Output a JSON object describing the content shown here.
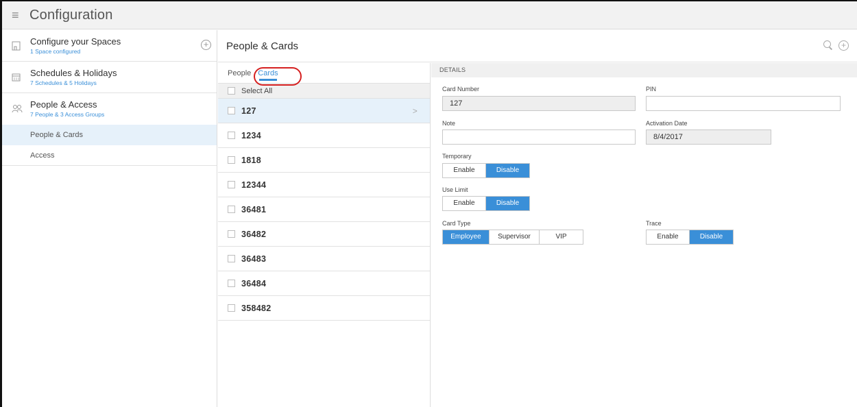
{
  "app": {
    "title": "Configuration"
  },
  "sidebar": {
    "items": [
      {
        "label": "Configure your Spaces",
        "sub": "1 Space configured",
        "add": "+"
      },
      {
        "label": "Schedules & Holidays",
        "sub": "7 Schedules & 5 Holidays"
      },
      {
        "label": "People & Access",
        "sub": "7 People & 3 Access Groups"
      }
    ],
    "subitems": [
      {
        "label": "People & Cards",
        "active": true
      },
      {
        "label": "Access",
        "active": false
      }
    ]
  },
  "content": {
    "title": "People & Cards"
  },
  "tabs": [
    {
      "label": "People",
      "active": false
    },
    {
      "label": "Cards",
      "active": true
    }
  ],
  "list": {
    "select_all": "Select All",
    "cards": [
      "127",
      "1234",
      "1818",
      "12344",
      "36481",
      "36482",
      "36483",
      "36484",
      "358482"
    ],
    "selected": "127",
    "chevron": ">"
  },
  "details": {
    "header": "DETAILS",
    "card_number": {
      "label": "Card Number",
      "value": "127"
    },
    "pin": {
      "label": "PIN",
      "value": ""
    },
    "note": {
      "label": "Note",
      "value": ""
    },
    "activation_date": {
      "label": "Activation Date",
      "value": "8/4/2017"
    },
    "temporary": {
      "label": "Temporary",
      "options": [
        "Enable",
        "Disable"
      ],
      "selected": "Disable"
    },
    "use_limit": {
      "label": "Use Limit",
      "options": [
        "Enable",
        "Disable"
      ],
      "selected": "Disable"
    },
    "card_type": {
      "label": "Card Type",
      "options": [
        "Employee",
        "Supervisor",
        "VIP"
      ],
      "selected": "Employee"
    },
    "trace": {
      "label": "Trace",
      "options": [
        "Enable",
        "Disable"
      ],
      "selected": "Disable"
    }
  },
  "colors": {
    "accent": "#3a8fd8",
    "highlight": "#e6f1fa",
    "annotation": "#d51f1f"
  }
}
